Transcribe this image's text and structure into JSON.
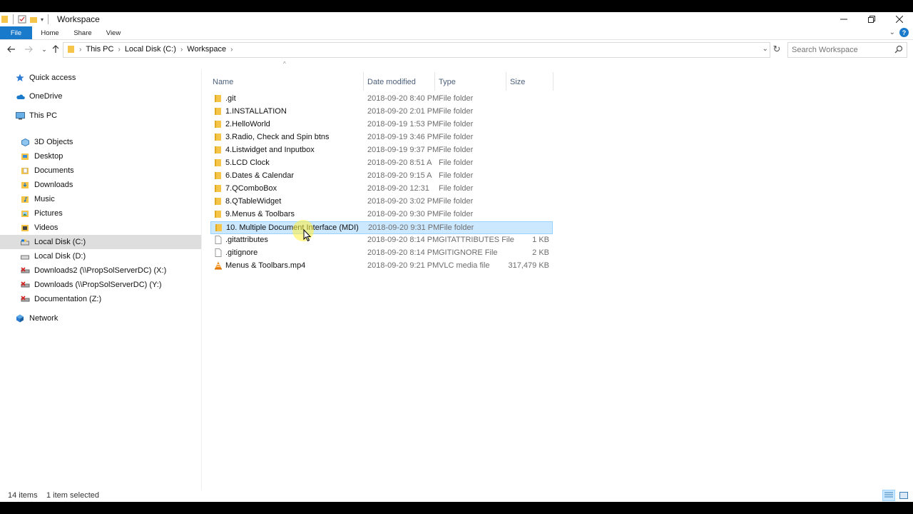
{
  "window": {
    "title": "Workspace"
  },
  "ribbon": {
    "tabs": [
      "File",
      "Home",
      "Share",
      "View"
    ]
  },
  "address": {
    "crumbs": [
      "This PC",
      "Local Disk (C:)",
      "Workspace"
    ]
  },
  "search": {
    "placeholder": "Search Workspace"
  },
  "navpane": {
    "items": [
      {
        "label": "Quick access",
        "icon": "star-icon"
      },
      {
        "label": "OneDrive",
        "icon": "cloud-icon"
      },
      {
        "label": "This PC",
        "icon": "computer-icon"
      },
      {
        "label": "3D Objects",
        "icon": "cube-icon"
      },
      {
        "label": "Desktop",
        "icon": "desktop-icon"
      },
      {
        "label": "Documents",
        "icon": "documents-icon"
      },
      {
        "label": "Downloads",
        "icon": "downloads-icon"
      },
      {
        "label": "Music",
        "icon": "music-icon"
      },
      {
        "label": "Pictures",
        "icon": "pictures-icon"
      },
      {
        "label": "Videos",
        "icon": "videos-icon"
      },
      {
        "label": "Local Disk (C:)",
        "icon": "drive-icon"
      },
      {
        "label": "Local Disk (D:)",
        "icon": "drive-icon"
      },
      {
        "label": "Downloads2 (\\\\PropSolServerDC) (X:)",
        "icon": "disconnected-drive-icon"
      },
      {
        "label": "Downloads (\\\\PropSolServerDC) (Y:)",
        "icon": "disconnected-drive-icon"
      },
      {
        "label": "Documentation (Z:)",
        "icon": "disconnected-drive-icon"
      },
      {
        "label": "Network",
        "icon": "network-icon"
      }
    ]
  },
  "columns": {
    "name": "Name",
    "date": "Date modified",
    "type": "Type",
    "size": "Size"
  },
  "files": [
    {
      "name": ".git",
      "date": "2018-09-20 8:40 PM",
      "type": "File folder",
      "size": "",
      "icon": "folder-icon"
    },
    {
      "name": "1.INSTALLATION",
      "date": "2018-09-20 2:01 PM",
      "type": "File folder",
      "size": "",
      "icon": "folder-icon"
    },
    {
      "name": "2.HelloWorld",
      "date": "2018-09-19 1:53 PM",
      "type": "File folder",
      "size": "",
      "icon": "folder-icon"
    },
    {
      "name": "3.Radio, Check and Spin btns",
      "date": "2018-09-19 3:46 PM",
      "type": "File folder",
      "size": "",
      "icon": "folder-icon"
    },
    {
      "name": "4.Listwidget and Inputbox",
      "date": "2018-09-19 9:37 PM",
      "type": "File folder",
      "size": "",
      "icon": "folder-icon"
    },
    {
      "name": "5.LCD Clock",
      "date": "2018-09-20 8:51 A",
      "type": "File folder",
      "size": "",
      "icon": "folder-icon"
    },
    {
      "name": "6.Dates & Calendar",
      "date": "2018-09-20 9:15 A",
      "type": "File folder",
      "size": "",
      "icon": "folder-icon"
    },
    {
      "name": "7.QComboBox",
      "date": "2018-09-20 12:31",
      "type": "File folder",
      "size": "",
      "icon": "folder-icon"
    },
    {
      "name": "8.QTableWidget",
      "date": "2018-09-20 3:02 PM",
      "type": "File folder",
      "size": "",
      "icon": "folder-icon"
    },
    {
      "name": "9.Menus & Toolbars",
      "date": "2018-09-20 9:30 PM",
      "type": "File folder",
      "size": "",
      "icon": "folder-icon"
    },
    {
      "name": "10. Multiple Document Interface (MDI)",
      "date": "2018-09-20 9:31 PM",
      "type": "File folder",
      "size": "",
      "icon": "folder-icon",
      "selected": true
    },
    {
      "name": ".gitattributes",
      "date": "2018-09-20 8:14 PM",
      "type": "GITATTRIBUTES File",
      "size": "1 KB",
      "icon": "file-icon"
    },
    {
      "name": ".gitignore",
      "date": "2018-09-20 8:14 PM",
      "type": "GITIGNORE File",
      "size": "2 KB",
      "icon": "file-icon"
    },
    {
      "name": "Menus & Toolbars.mp4",
      "date": "2018-09-20 9:21 PM",
      "type": "VLC media file",
      "size": "317,479 KB",
      "icon": "vlc-icon"
    }
  ],
  "status": {
    "count": "14 items",
    "selection": "1 item selected"
  },
  "colors": {
    "accent": "#1979ca",
    "selection": "#cce8ff",
    "folder": "#f5c54a"
  }
}
